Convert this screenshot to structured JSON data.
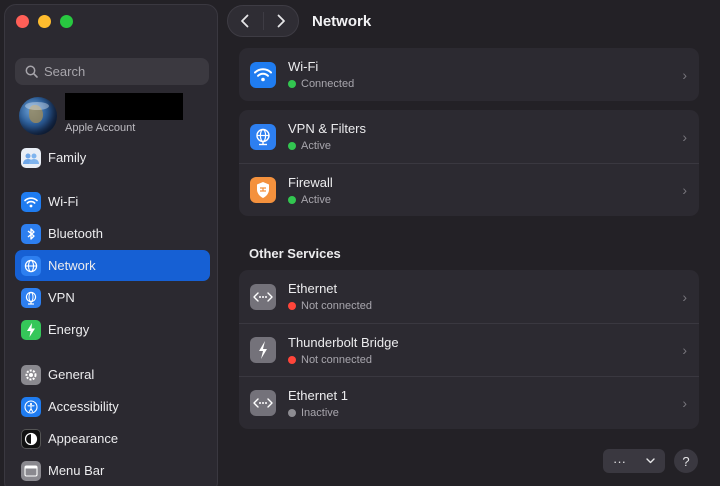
{
  "window": {
    "title": "Network"
  },
  "sidebar": {
    "search_placeholder": "Search",
    "account": {
      "name": "",
      "subtitle": "Apple Account"
    },
    "family": "Family",
    "items": [
      {
        "label": "Wi-Fi",
        "icon": "wifi-icon"
      },
      {
        "label": "Bluetooth",
        "icon": "bluetooth-icon"
      },
      {
        "label": "Network",
        "icon": "globe-icon",
        "active": true
      },
      {
        "label": "VPN",
        "icon": "vpn-icon"
      },
      {
        "label": "Energy",
        "icon": "energy-icon"
      },
      {
        "label": "General",
        "icon": "gear-icon"
      },
      {
        "label": "Accessibility",
        "icon": "accessibility-icon"
      },
      {
        "label": "Appearance",
        "icon": "appearance-icon"
      },
      {
        "label": "Menu Bar",
        "icon": "menu-bar-icon"
      }
    ]
  },
  "services": [
    {
      "name": "Wi-Fi",
      "status": "Connected",
      "status_color": "#32c650"
    }
  ],
  "security": [
    {
      "name": "VPN & Filters",
      "status": "Active",
      "status_color": "#32c650"
    },
    {
      "name": "Firewall",
      "status": "Active",
      "status_color": "#32c650"
    }
  ],
  "other_services_title": "Other Services",
  "other_services": [
    {
      "name": "Ethernet",
      "status": "Not connected",
      "status_color": "#ff453a"
    },
    {
      "name": "Thunderbolt Bridge",
      "status": "Not connected",
      "status_color": "#ff453a"
    },
    {
      "name": "Ethernet 1",
      "status": "Inactive",
      "status_color": "#8d8c92"
    }
  ],
  "footer": {
    "more_label": "···",
    "help_label": "?"
  },
  "colors": {
    "accent": "#1660d4"
  }
}
